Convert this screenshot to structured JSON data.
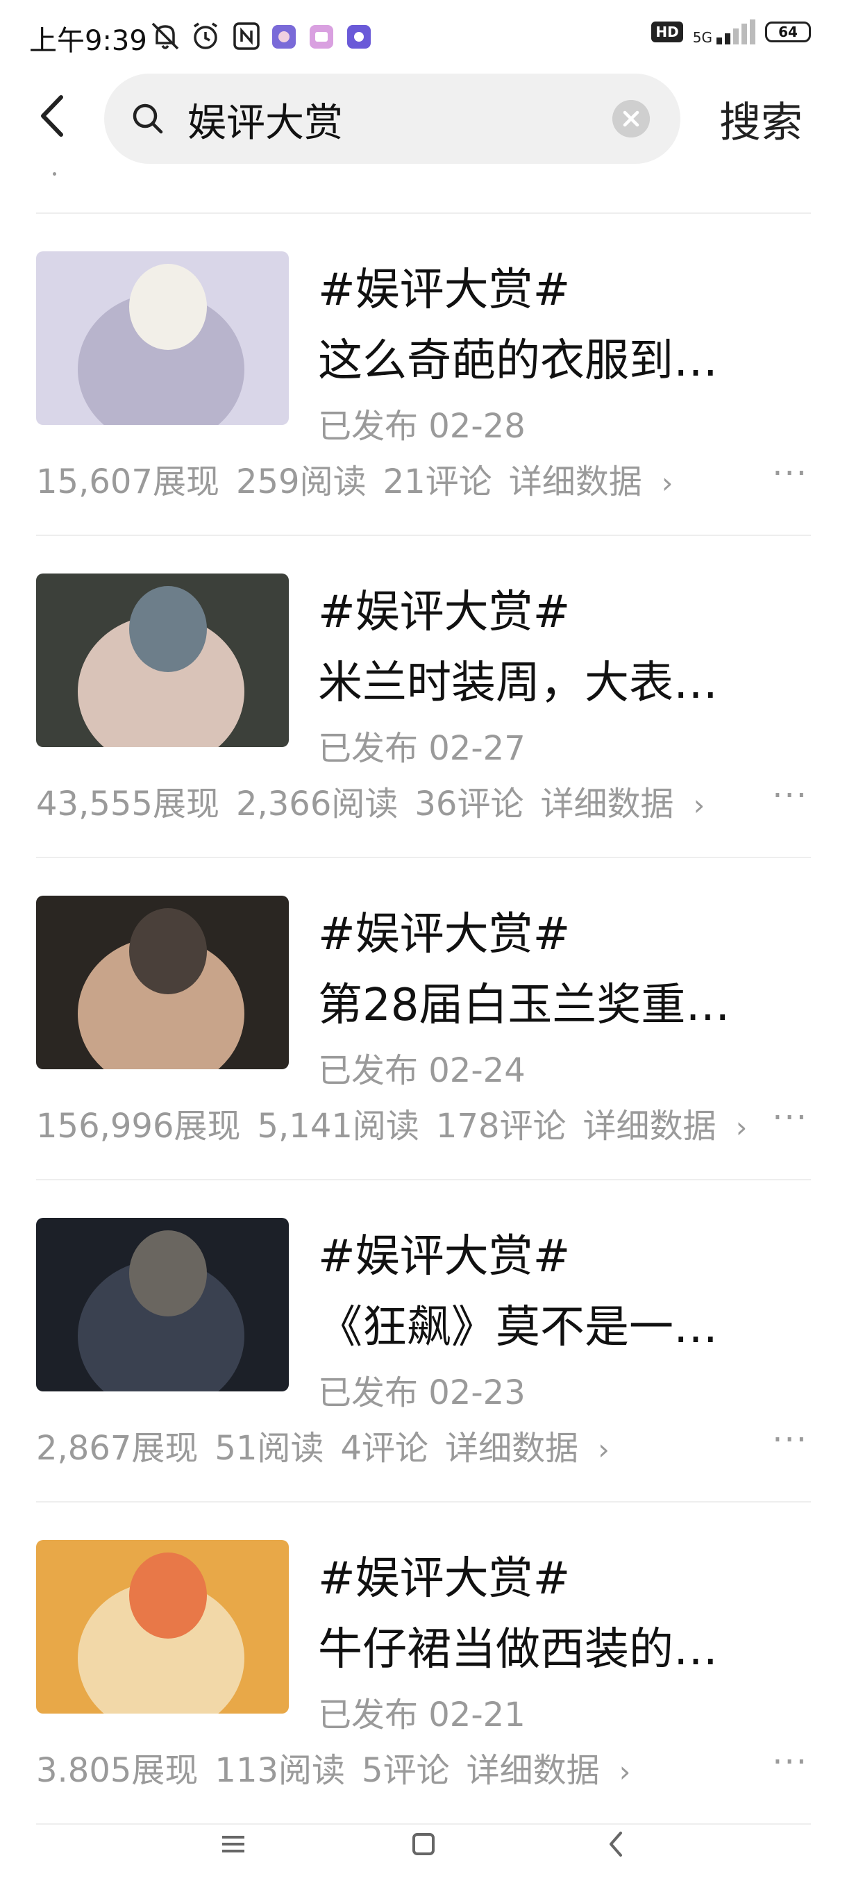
{
  "status_bar": {
    "time": "上午9:39",
    "network": "5G",
    "hd_badge": "HD",
    "battery": "64"
  },
  "header": {
    "search_value": "娱评大赏",
    "search_button": "搜索"
  },
  "items": [
    {
      "tag": "#娱评大赏#",
      "title": "这么奇葩的衣服到…",
      "date": "已发布  02-28",
      "impressions": "15,607展现",
      "reads": "259阅读",
      "comments": "21评论",
      "detail": "详细数据",
      "thumb_colors": [
        "#d9d6e8",
        "#b8b4cc",
        "#f2efe8"
      ]
    },
    {
      "tag": "#娱评大赏#",
      "title": "米兰时装周，大表…",
      "date": "已发布  02-27",
      "impressions": "43,555展现",
      "reads": "2,366阅读",
      "comments": "36评论",
      "detail": "详细数据",
      "thumb_colors": [
        "#3c403a",
        "#d9c3b8",
        "#6d7e8a"
      ]
    },
    {
      "tag": "#娱评大赏#",
      "title": "第28届白玉兰奖重…",
      "date": "已发布  02-24",
      "impressions": "156,996展现",
      "reads": "5,141阅读",
      "comments": "178评论",
      "detail": "详细数据",
      "thumb_colors": [
        "#2a2622",
        "#c8a48a",
        "#4a403a"
      ]
    },
    {
      "tag": "#娱评大赏#",
      "title": "《狂飙》莫不是一…",
      "date": "已发布  02-23",
      "impressions": "2,867展现",
      "reads": "51阅读",
      "comments": "4评论",
      "detail": "详细数据",
      "thumb_colors": [
        "#1c2028",
        "#3a4150",
        "#6a6660"
      ]
    },
    {
      "tag": "#娱评大赏#",
      "title": "牛仔裙当做西装的…",
      "date": "已发布  02-21",
      "impressions": "3.805展现",
      "reads": "113阅读",
      "comments": "5评论",
      "detail": "详细数据",
      "thumb_colors": [
        "#e8a848",
        "#f2d8a8",
        "#e87848"
      ]
    }
  ],
  "more_icon": "more-dots-icon"
}
